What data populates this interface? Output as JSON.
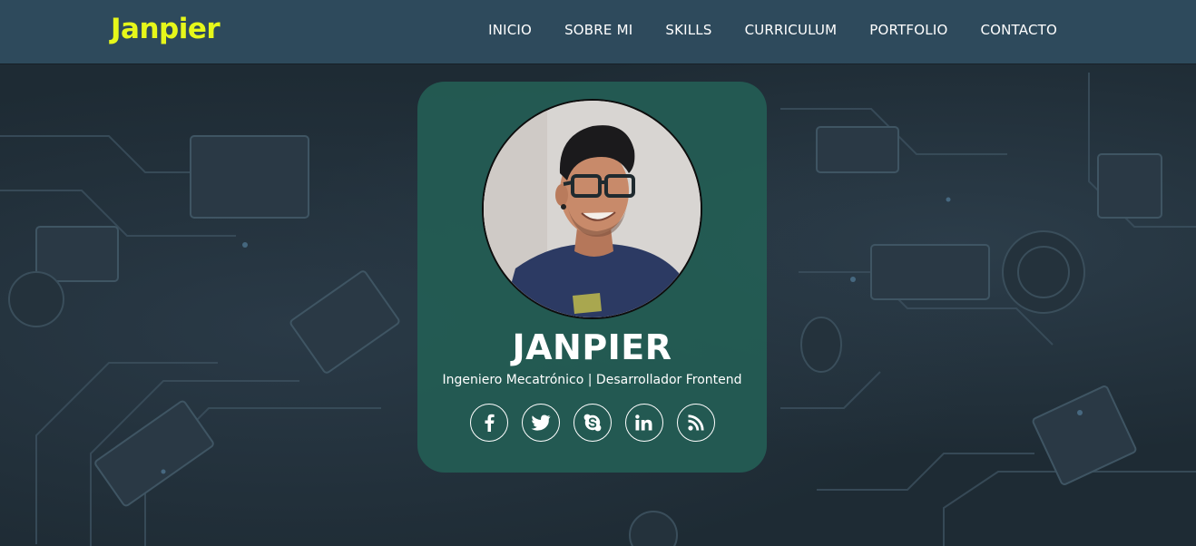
{
  "brand": {
    "logo_text": "Janpier",
    "accent_color": "#e6f71a"
  },
  "nav": {
    "items": [
      {
        "label": "INICIO"
      },
      {
        "label": "SOBRE MI"
      },
      {
        "label": "SKILLS"
      },
      {
        "label": "CURRICULUM"
      },
      {
        "label": "PORTFOLIO"
      },
      {
        "label": "CONTACTO"
      }
    ],
    "background_color": "#2e4a5c"
  },
  "profile": {
    "name": "JANPIER",
    "subtitle": "Ingeniero Mecatrónico | Desarrollador Frontend",
    "photo_icon": "profile-photo",
    "card_color": "#245c54"
  },
  "socials": [
    {
      "icon": "facebook-icon"
    },
    {
      "icon": "twitter-icon"
    },
    {
      "icon": "skype-icon"
    },
    {
      "icon": "linkedin-icon"
    },
    {
      "icon": "rss-icon"
    }
  ],
  "background": {
    "image": "circuit-board-background",
    "color": "#1e2b34"
  }
}
